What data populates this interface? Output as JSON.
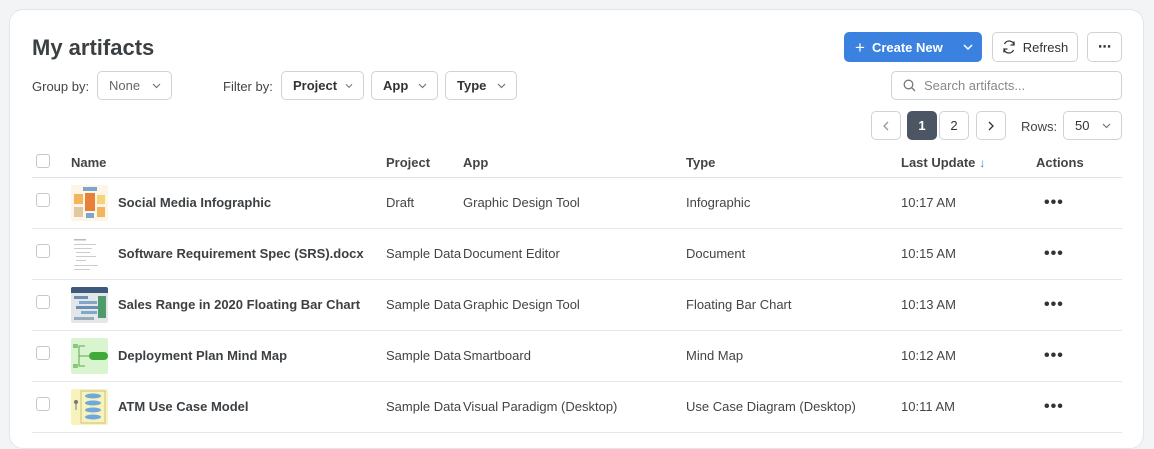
{
  "header": {
    "title": "My artifacts",
    "create_label": "Create New",
    "refresh_label": "Refresh",
    "more_label": "⋯"
  },
  "toolbar": {
    "group_by_label": "Group by:",
    "group_by_value": "None",
    "filter_by_label": "Filter by:",
    "filters": [
      "Project",
      "App",
      "Type"
    ],
    "search_placeholder": "Search artifacts..."
  },
  "pagination": {
    "pages": [
      "1",
      "2"
    ],
    "current": "1",
    "rows_label": "Rows:",
    "rows_value": "50"
  },
  "table": {
    "columns": [
      "Name",
      "Project",
      "App",
      "Type",
      "Last Update",
      "Actions"
    ],
    "rows": [
      {
        "name": "Social Media Infographic",
        "project": "Draft",
        "app": "Graphic Design Tool",
        "type": "Infographic",
        "updated": "10:17 AM",
        "thumb": "infographic"
      },
      {
        "name": "Software Requirement Spec (SRS).docx",
        "project": "Sample Data",
        "app": "Document Editor",
        "type": "Document",
        "updated": "10:15 AM",
        "thumb": "document"
      },
      {
        "name": "Sales Range in 2020 Floating Bar Chart",
        "project": "Sample Data",
        "app": "Graphic Design Tool",
        "type": "Floating Bar Chart",
        "updated": "10:13 AM",
        "thumb": "chart"
      },
      {
        "name": "Deployment Plan Mind Map",
        "project": "Sample Data",
        "app": "Smartboard",
        "type": "Mind Map",
        "updated": "10:12 AM",
        "thumb": "mindmap"
      },
      {
        "name": "ATM Use Case Model",
        "project": "Sample Data",
        "app": "Visual Paradigm (Desktop)",
        "type": "Use Case Diagram (Desktop)",
        "updated": "10:11 AM",
        "thumb": "usecase"
      }
    ],
    "actions_label": "•••"
  },
  "colors": {
    "accent": "#3b82e0",
    "active_page": "#4b5563"
  }
}
